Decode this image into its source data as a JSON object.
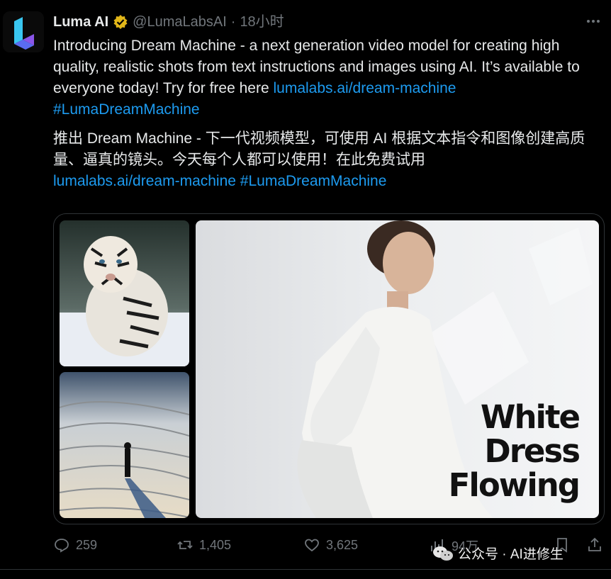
{
  "tweet": {
    "author_name": "Luma AI",
    "handle": "@LumaLabsAI",
    "separator": "·",
    "time": "18小时",
    "text_en": "Introducing Dream Machine - a next generation video model for creating high quality, realistic shots from text instructions and images using AI. It’s available to everyone today! Try for free here ",
    "link_en": "lumalabs.ai/dream-machine",
    "hashtag_en": "#LumaDreamMachine",
    "text_zh": "推出 Dream Machine - 下一代视频模型，可使用 AI 根据文本指令和图像创建高质量、逼真的镜头。今天每个人都可以使用！在此免费试用",
    "link_zh": "lumalabs.ai/dream-machine",
    "hashtag_zh": "#LumaDreamMachine",
    "media_caption_lines": [
      "White",
      "Dress",
      "Flowing"
    ]
  },
  "actions": {
    "replies": "259",
    "retweets": "1,405",
    "likes": "3,625",
    "views": "94万"
  },
  "watermark": {
    "text": "公众号 · AI进修生"
  },
  "icons": {
    "reply": "reply-icon",
    "retweet": "retweet-icon",
    "like": "heart-icon",
    "views": "views-icon",
    "bookmark": "bookmark-icon",
    "share": "share-icon",
    "more": "more-icon",
    "verified": "verified-badge-icon"
  },
  "colors": {
    "background": "#000000",
    "text": "#e7e9ea",
    "muted": "#71767b",
    "link": "#1d9bf0",
    "verified": "#e2b719"
  }
}
